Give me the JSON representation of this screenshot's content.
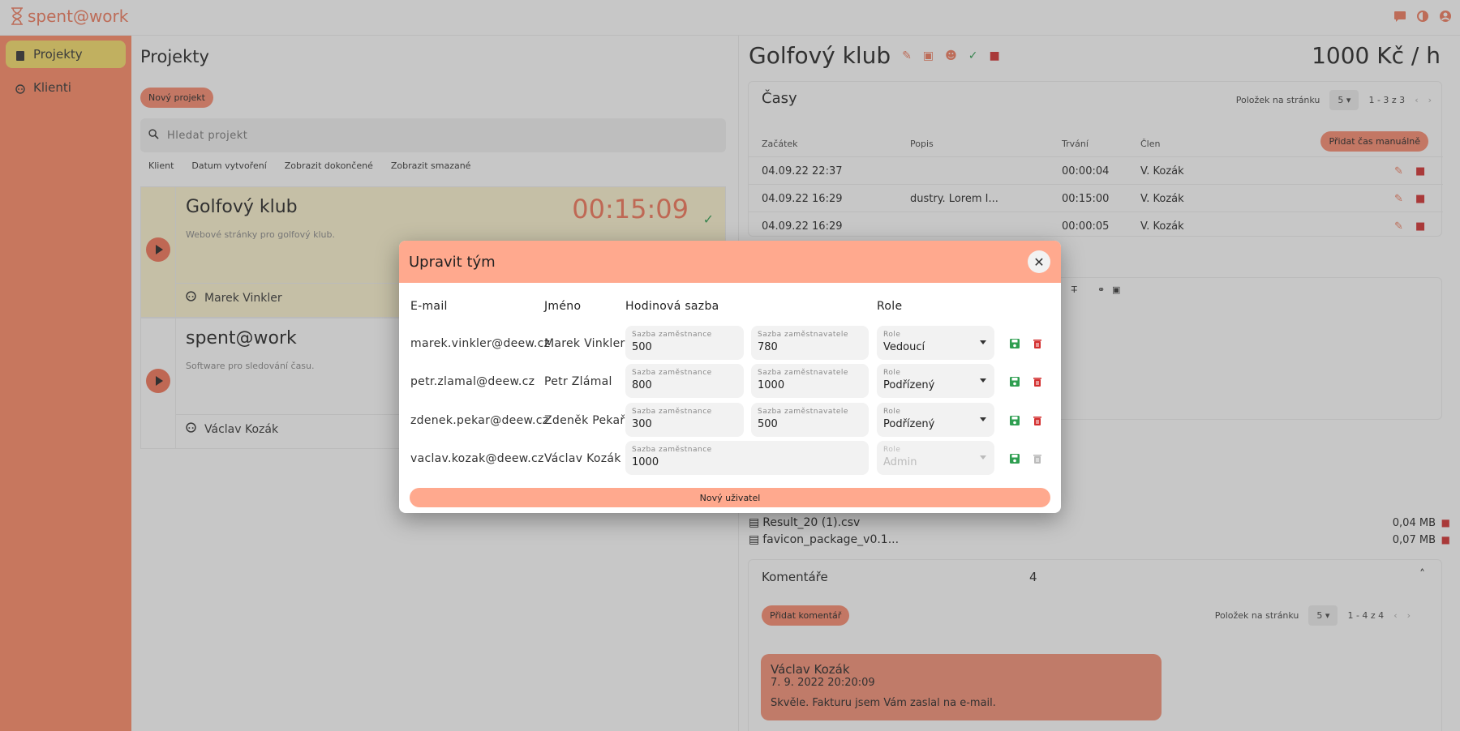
{
  "app": {
    "logo_text": "spent@work",
    "accent": "#f07a5c"
  },
  "sidebar": {
    "items": [
      {
        "label": "Projekty",
        "icon": "book-icon",
        "active": true
      },
      {
        "label": "Klienti",
        "icon": "face-icon",
        "active": false
      }
    ]
  },
  "projects_pane": {
    "title": "Projekty",
    "new_project_label": "Nový projekt",
    "search_placeholder": "Hledat projekt",
    "filters": [
      "Klient",
      "Datum vytvoření",
      "Zobrazit dokončené",
      "Zobrazit smazané"
    ],
    "projects": [
      {
        "name": "Golfový klub",
        "description": "Webové stránky pro golfový klub.",
        "timer": "00:15:09",
        "owner": "Marek Vinkler"
      },
      {
        "name": "spent@work",
        "description": "Software pro sledování času.",
        "timer": "",
        "owner": "Václav Kozák"
      }
    ]
  },
  "detail": {
    "title": "Golfový klub",
    "rate": "1000 Kč / h",
    "times": {
      "title": "Časy",
      "per_page_label": "Položek na stránku",
      "per_page_value": "5",
      "range": "1 - 3 z 3",
      "add_button": "Přidat čas manuálně",
      "columns": [
        "Začátek",
        "Popis",
        "Trvání",
        "Člen"
      ],
      "rows": [
        {
          "start": "04.09.22 22:37",
          "desc": "",
          "duration": "00:00:04",
          "member": "V. Kozák"
        },
        {
          "start": "04.09.22 16:29",
          "desc": "dustry. Lorem I...",
          "duration": "00:15:00",
          "member": "V. Kozák"
        },
        {
          "start": "04.09.22 16:29",
          "desc": "",
          "duration": "00:00:05",
          "member": "V. Kozák"
        }
      ]
    },
    "files": [
      {
        "name": "Result_20 (1).csv",
        "size": "0,04 MB"
      },
      {
        "name": "favicon_package_v0.1...",
        "size": "0,07 MB"
      }
    ],
    "comments": {
      "title": "Komentáře",
      "count": "4",
      "add_button": "Přidat komentář",
      "per_page_label": "Položek na stránku",
      "per_page_value": "5",
      "range": "1 - 4 z 4",
      "items": [
        {
          "author": "Václav Kozák",
          "date": "7. 9. 2022 20:20:09",
          "text": "Skvěle. Fakturu jsem Vám zaslal na e-mail."
        }
      ]
    }
  },
  "modal": {
    "title": "Upravit tým",
    "headers": {
      "email": "E-mail",
      "name": "Jméno",
      "rate": "Hodinová sazba",
      "role": "Role"
    },
    "employee_rate_label": "Sazba zaměstnance",
    "employer_rate_label": "Sazba zaměstnavatele",
    "role_label": "Role",
    "rows": [
      {
        "email": "marek.vinkler@deew.cz",
        "name": "Marek Vinkler",
        "employee_rate": "500",
        "employer_rate": "780",
        "role": "Vedoucí"
      },
      {
        "email": "petr.zlamal@deew.cz",
        "name": "Petr Zlámal",
        "employee_rate": "800",
        "employer_rate": "1000",
        "role": "Podřízený"
      },
      {
        "email": "zdenek.pekar@deew.cz",
        "name": "Zdeněk Pekař",
        "employee_rate": "300",
        "employer_rate": "500",
        "role": "Podřízený"
      },
      {
        "email": "vaclav.kozak@deew.cz",
        "name": "Václav Kozák",
        "employee_rate": "1000",
        "employer_rate": "",
        "role": "Admin"
      }
    ],
    "new_user_label": "Nový uživatel"
  }
}
